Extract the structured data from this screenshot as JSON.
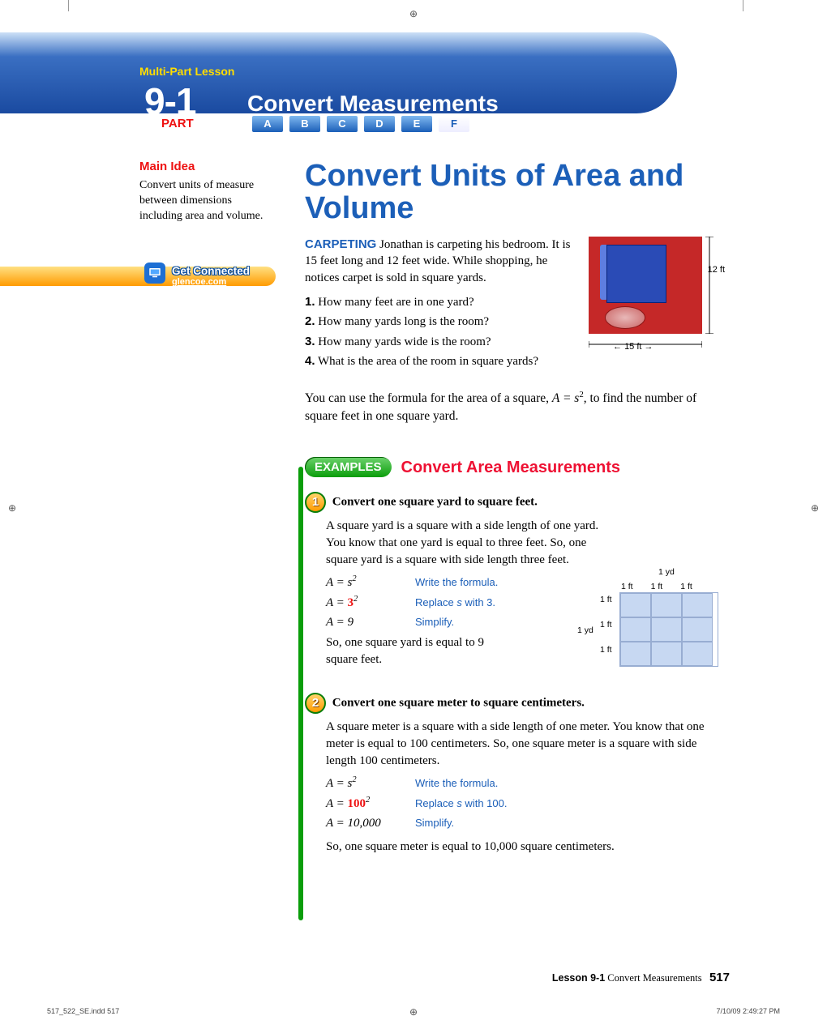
{
  "header": {
    "mpl": "Multi-Part Lesson",
    "num": "9-1",
    "title": "Convert Measurements",
    "part": "PART",
    "tabs": [
      "A",
      "B",
      "C",
      "D",
      "E",
      "F"
    ],
    "active_tab": "F"
  },
  "sidebar": {
    "main_idea_hdr": "Main Idea",
    "main_idea": "Convert units of measure between dimensions including area and volume.",
    "get_connected": "Get Connected",
    "link": "glencoe.com"
  },
  "main": {
    "title": "Convert Units of Area and Volume",
    "carpeting_label": "CARPETING",
    "intro": "Jonathan is carpeting his bedroom. It is 15 feet long and 12 feet wide. While shopping, he notices carpet is sold in square yards.",
    "q1": "How many feet are in one yard?",
    "q2": "How many yards long is the room?",
    "q3": "How many yards wide is the room?",
    "q4": "What is the area of the room in square yards?",
    "room_12": "12 ft",
    "room_15": "15 ft",
    "tip_pre": "You can use the formula for the area of a square, ",
    "formula_inline": "A = s",
    "tip_post": ", to find the number of square feet in one square yard."
  },
  "examples_header": {
    "pill": "EXAMPLES",
    "subtitle": "Convert Area Measurements"
  },
  "ex1": {
    "num": "1",
    "title": "Convert one square yard to square feet.",
    "body": "A square yard is a square with a side length of one yard. You know that one yard is equal to three feet. So, one square yard is a square with side length three feet.",
    "rows": [
      {
        "eq": "A = s",
        "sup": "2",
        "note": "Write the formula."
      },
      {
        "eq": "A = ",
        "bold": "3",
        "sup": "2",
        "note": "Replace s with 3."
      },
      {
        "eq": "A = 9",
        "note": "Simplify."
      }
    ],
    "conclusion": "So, one square yard is equal to 9 square feet.",
    "fig": {
      "one_ft": "1 ft",
      "one_yd": "1 yd"
    }
  },
  "ex2": {
    "num": "2",
    "title": "Convert one square meter to square centimeters.",
    "body": "A square meter is a square with a side length of one meter. You know that one meter is equal to 100 centimeters. So, one square meter is a square with side length 100 centimeters.",
    "rows": [
      {
        "eq": "A = s",
        "sup": "2",
        "note": "Write the formula."
      },
      {
        "eq": "A = ",
        "bold": "100",
        "sup": "2",
        "note": "Replace s with 100."
      },
      {
        "eq": "A = 10,000",
        "note": "Simplify."
      }
    ],
    "conclusion": "So, one square meter is equal to 10,000 square centimeters."
  },
  "footer": {
    "lesson": "Lesson 9-1",
    "title": "Convert Measurements",
    "page": "517",
    "slug": "517_522_SE.indd   517",
    "ts": "7/10/09   2:49:27 PM"
  }
}
